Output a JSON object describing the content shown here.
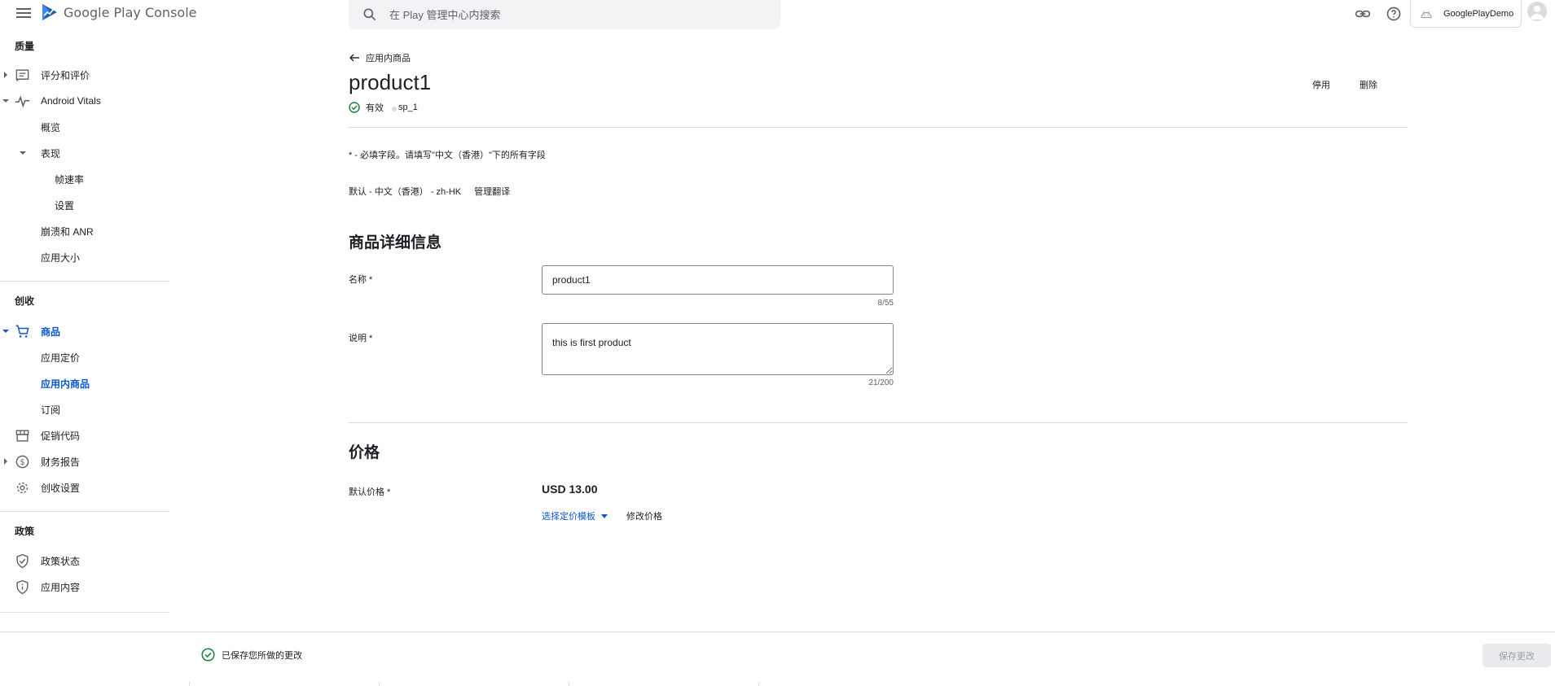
{
  "app": {
    "logo_text": "Google Play Console",
    "search_placeholder": "在 Play 管理中心内搜索",
    "account_name": "GooglePlayDemo"
  },
  "sidebar": {
    "sections": [
      {
        "title": "质量"
      },
      {
        "title": "创收"
      },
      {
        "title": "政策"
      }
    ],
    "items": [
      {
        "label": "评分和评价",
        "icon": "rating-icon"
      },
      {
        "label": "Android Vitals",
        "icon": "vitals-icon"
      },
      {
        "label": "概览"
      },
      {
        "label": "表现"
      },
      {
        "label": "帧速率"
      },
      {
        "label": "设置"
      },
      {
        "label": "崩溃和 ANR"
      },
      {
        "label": "应用大小"
      },
      {
        "label": "商品",
        "icon": "cart-icon",
        "active": true
      },
      {
        "label": "应用定价"
      },
      {
        "label": "应用内商品",
        "active": true
      },
      {
        "label": "订阅"
      },
      {
        "label": "促销代码",
        "icon": "store-icon"
      },
      {
        "label": "财务报告",
        "icon": "dollar-icon"
      },
      {
        "label": "创收设置",
        "icon": "gear-icon"
      },
      {
        "label": "政策状态",
        "icon": "shield-icon"
      },
      {
        "label": "应用内容",
        "icon": "info-shield-icon"
      }
    ]
  },
  "main": {
    "back_label": "应用内商品",
    "title": "product1",
    "status": "有效",
    "product_id": "sp_1",
    "deactivate_label": "停用",
    "delete_label": "删除",
    "required_note": "* - 必填字段。请填写\"中文（香港）\"下的所有字段",
    "default_language": "默认 - 中文（香港） - zh-HK",
    "manage_translations": "管理翻译",
    "details_heading": "商品详细信息",
    "name_label": "名称 *",
    "name_value": "product1",
    "name_counter": "8/55",
    "desc_label": "说明 *",
    "desc_value": "this is first product",
    "desc_counter": "21/200",
    "price_heading": "价格",
    "default_price_label": "默认价格 *",
    "default_price": "USD 13.00",
    "pricing_template_link": "选择定价模板",
    "edit_price_link": "修改价格"
  },
  "footer": {
    "saved_text": "已保存您所做的更改",
    "save_button": "保存更改"
  },
  "colors": {
    "accent": "#0b57d0",
    "success": "#188038",
    "divider": "#dadce0"
  }
}
